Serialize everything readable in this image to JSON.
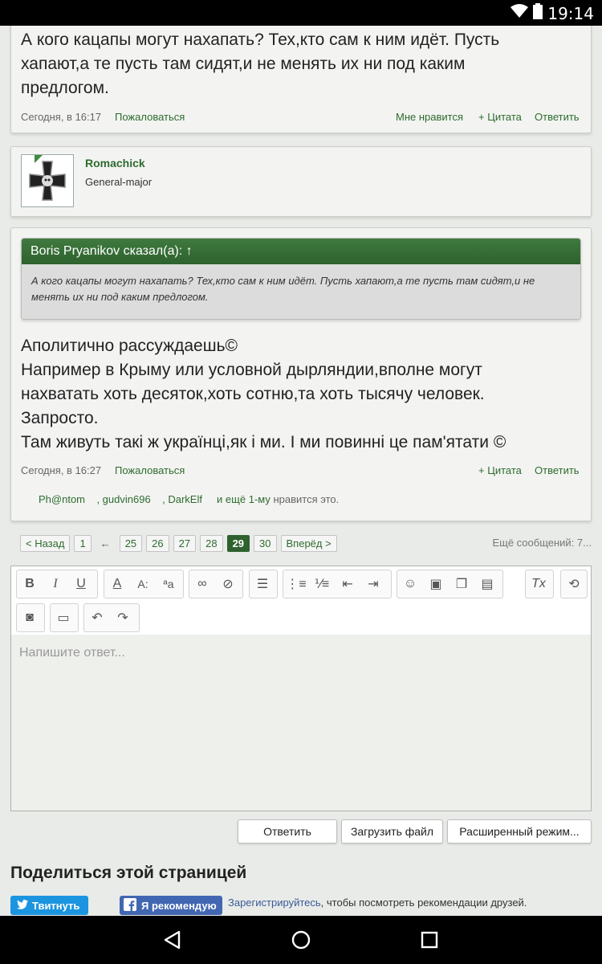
{
  "status_bar": {
    "time": "19:14",
    "icons": [
      "wifi-icon",
      "battery-icon"
    ]
  },
  "post1": {
    "lines": [
      "А кого кацапы могут нахапать? Тех,кто сам к ним идёт. Пусть",
      "хапают,а те пусть там сидят,и не менять их ни под каким",
      "предлогом."
    ],
    "timestamp": "Сегодня, в 16:17",
    "report": "Пожаловаться",
    "like": "Мне нравится",
    "quote": "+ Цитата",
    "reply": "Ответить"
  },
  "user": {
    "name": "Romachick",
    "title": "General-major",
    "avatar_icon": "iron-cross-icon"
  },
  "post2": {
    "quote_header": "Boris Pryanikov сказал(а): ↑",
    "quote_lines": [
      "А кого кацапы могут нахапать? Тех,кто сам к ним идёт. Пусть хапают,а те пусть там сидят,и не",
      "менять их ни под каким предлогом."
    ],
    "lines": [
      "Аполитично рассуждаешь©",
      "Например в Крыму или условной дырляндии,вполне могут",
      "нахватать хоть десяток,хоть сотню,та хоть тысячу человек.",
      "Запросто.",
      "Там живуть такі ж українці,як і ми. І ми повинні це пам'ятати ©"
    ],
    "timestamp": "Сегодня, в 16:27",
    "report": "Пожаловаться",
    "quote": "+ Цитата",
    "reply": "Ответить",
    "likes": {
      "users": [
        "Ph@ntom",
        ", gudvin696",
        ", DarkElf"
      ],
      "and_more": "и ещё 1-му",
      "suffix": "нравится это."
    }
  },
  "pagination": {
    "prev": "< Назад",
    "first": "1",
    "ellipsis": "←",
    "pages": [
      "25",
      "26",
      "27",
      "28",
      "29",
      "30"
    ],
    "current": "29",
    "next": "Вперёд >",
    "more": "Ещё сообщений: 7..."
  },
  "editor": {
    "placeholder": "Напишите ответ..."
  },
  "buttons": {
    "reply": "Ответить",
    "upload": "Загрузить файл",
    "advanced": "Расширенный режим..."
  },
  "share": {
    "title": "Поделиться этой страницей",
    "tweet": "Твитнуть",
    "recommend": "Я рекомендую",
    "register_link": "Зарегистрируйтесь",
    "register_text": ", чтобы посмотреть рекомендации друзей."
  }
}
